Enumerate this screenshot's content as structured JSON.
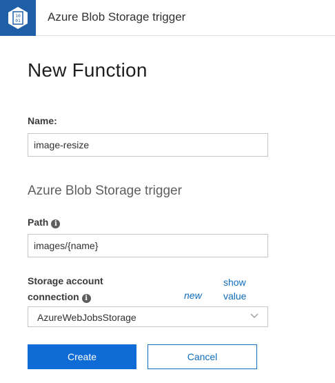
{
  "header": {
    "title": "Azure Blob Storage trigger",
    "icon": "blob-binary-icon",
    "icon_text_top": "10",
    "icon_text_bottom": "01",
    "icon_color": "#1f5fa8"
  },
  "page": {
    "title": "New Function"
  },
  "form": {
    "name_label": "Name:",
    "name_value": "image-resize",
    "section_title": "Azure Blob Storage trigger",
    "path_label": "Path",
    "path_value": "images/{name}",
    "storage_label_line1": "Storage account",
    "storage_label_line2": "connection",
    "new_link": "new",
    "show_value_line1": "show",
    "show_value_line2": "value",
    "storage_value": "AzureWebJobsStorage",
    "info_glyph": "i"
  },
  "buttons": {
    "create": "Create",
    "cancel": "Cancel"
  },
  "colors": {
    "accent": "#0f6cd6",
    "link": "#0f6cbd"
  }
}
